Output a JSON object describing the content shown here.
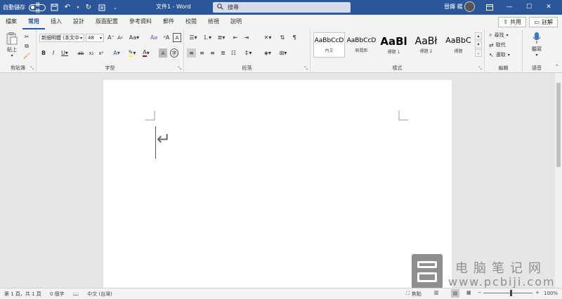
{
  "titlebar": {
    "autosave_label": "自動儲存",
    "autosave_state": "關閉",
    "doc_title": "文件1 - Word",
    "search_placeholder": "搜尋",
    "user_name": "晉鐸 楊",
    "brand_color": "#2b579a"
  },
  "tabs": [
    "檔案",
    "常用",
    "插入",
    "設計",
    "版面配置",
    "參考資料",
    "郵件",
    "校閱",
    "檢視",
    "說明"
  ],
  "active_tab": "常用",
  "share_label": "共用",
  "comment_label": "註解",
  "ribbon": {
    "clipboard": {
      "paste_label": "貼上",
      "group_label": "剪貼簿"
    },
    "font": {
      "font_name": "新細明體 (本文中",
      "font_size": "48",
      "group_label": "字型"
    },
    "paragraph": {
      "group_label": "段落"
    },
    "styles": {
      "group_label": "樣式",
      "items": [
        {
          "sample": "AaBbCcD",
          "name": "內文"
        },
        {
          "sample": "AaBbCcD",
          "name": "無間距"
        },
        {
          "sample": "AaBl",
          "name": "標題 1"
        },
        {
          "sample": "AaBł",
          "name": "標題 2"
        },
        {
          "sample": "AaBbC",
          "name": "標題"
        }
      ]
    },
    "editing": {
      "find_label": "尋找",
      "replace_label": "取代",
      "select_label": "選取",
      "group_label": "編輯"
    },
    "voice": {
      "dictate_label": "聽寫",
      "group_label": "語音"
    }
  },
  "document": {
    "para_mark": "↵"
  },
  "statusbar": {
    "page": "第 1 頁，共 1 頁",
    "words": "0 個字",
    "language": "中文 (台灣)",
    "focus": "焦點",
    "zoom": "100%"
  },
  "watermark": {
    "cn": "电脑笔记网",
    "url": "www.pcbiji.com"
  }
}
